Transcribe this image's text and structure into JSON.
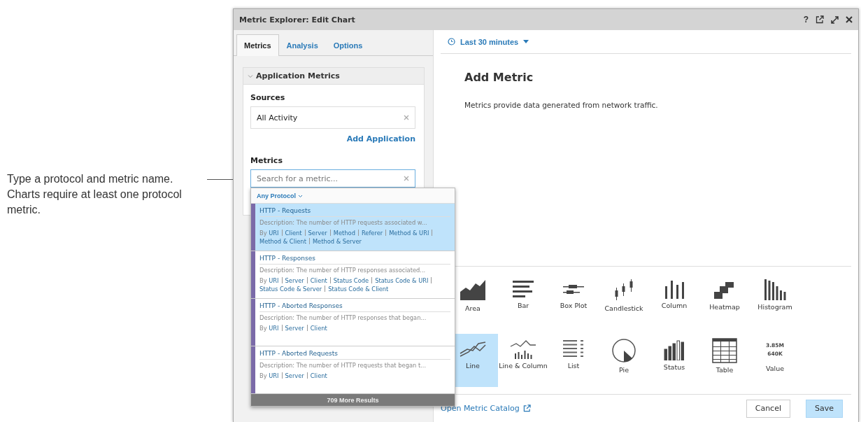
{
  "annotation": {
    "text": "Type a protocol and metric name. Charts require at least one protocol metric."
  },
  "window": {
    "title": "Metric Explorer: Edit Chart",
    "help": "?"
  },
  "tabs": [
    {
      "label": "Metrics",
      "selected": true
    },
    {
      "label": "Analysis",
      "selected": false
    },
    {
      "label": "Options",
      "selected": false
    }
  ],
  "section": {
    "title": "Application Metrics",
    "expanded": true,
    "sources_label": "Sources",
    "source_value": "All Activity",
    "add_link": "Add Application",
    "metrics_label": "Metrics",
    "search_placeholder": "Search for a metric..."
  },
  "dropdown": {
    "filter": "Any Protocol",
    "more": "709 More Results",
    "items": [
      {
        "title": "HTTP - Requests",
        "description": "Description: The number of HTTP requests associated w...",
        "by": "By",
        "links": [
          "URI",
          "Client",
          "Server",
          "Method",
          "Referer",
          "Method & URI",
          "Method & Client",
          "Method & Server"
        ],
        "selected": true
      },
      {
        "title": "HTTP - Responses",
        "description": "Description: The number of HTTP responses associated...",
        "by": "By",
        "links": [
          "URI",
          "Server",
          "Client",
          "Status Code",
          "Status Code & URI",
          "Status Code & Server",
          "Status Code & Client"
        ],
        "selected": false
      },
      {
        "title": "HTTP - Aborted Responses",
        "description": "Description: The number of HTTP responses that began...",
        "by": "By",
        "links": [
          "URI",
          "Server",
          "Client"
        ],
        "selected": false
      },
      {
        "title": "HTTP - Aborted Requests",
        "description": "Description: The number of HTTP requests that began t...",
        "by": "By",
        "links": [
          "URI",
          "Server",
          "Client"
        ],
        "selected": false
      }
    ]
  },
  "time_range": "Last 30 minutes",
  "heading": "Add Metric",
  "description": "Metrics provide data generated from network traffic.",
  "chart_types": [
    {
      "kind": "area",
      "label": "Area",
      "selected": false
    },
    {
      "kind": "bar",
      "label": "Bar",
      "selected": false
    },
    {
      "kind": "boxplot",
      "label": "Box Plot",
      "selected": false
    },
    {
      "kind": "candlestick",
      "label": "Candlestick",
      "selected": false
    },
    {
      "kind": "column",
      "label": "Column",
      "selected": false
    },
    {
      "kind": "heatmap",
      "label": "Heatmap",
      "selected": false
    },
    {
      "kind": "histogram",
      "label": "Histogram",
      "selected": false
    },
    {
      "kind": "line",
      "label": "Line",
      "selected": true
    },
    {
      "kind": "linecolumn",
      "label": "Line & Column",
      "selected": false
    },
    {
      "kind": "list",
      "label": "List",
      "selected": false
    },
    {
      "kind": "pie",
      "label": "Pie",
      "selected": false
    },
    {
      "kind": "status",
      "label": "Status",
      "selected": false
    },
    {
      "kind": "table",
      "label": "Table",
      "selected": false
    },
    {
      "kind": "value",
      "label": "Value",
      "selected": false,
      "sample": [
        "3.85M",
        "640K"
      ]
    }
  ],
  "catalog_link": "Open Metric Catalog",
  "buttons": [
    {
      "label": "Cancel",
      "kind": "secondary"
    },
    {
      "label": "Save",
      "kind": "primary"
    }
  ]
}
